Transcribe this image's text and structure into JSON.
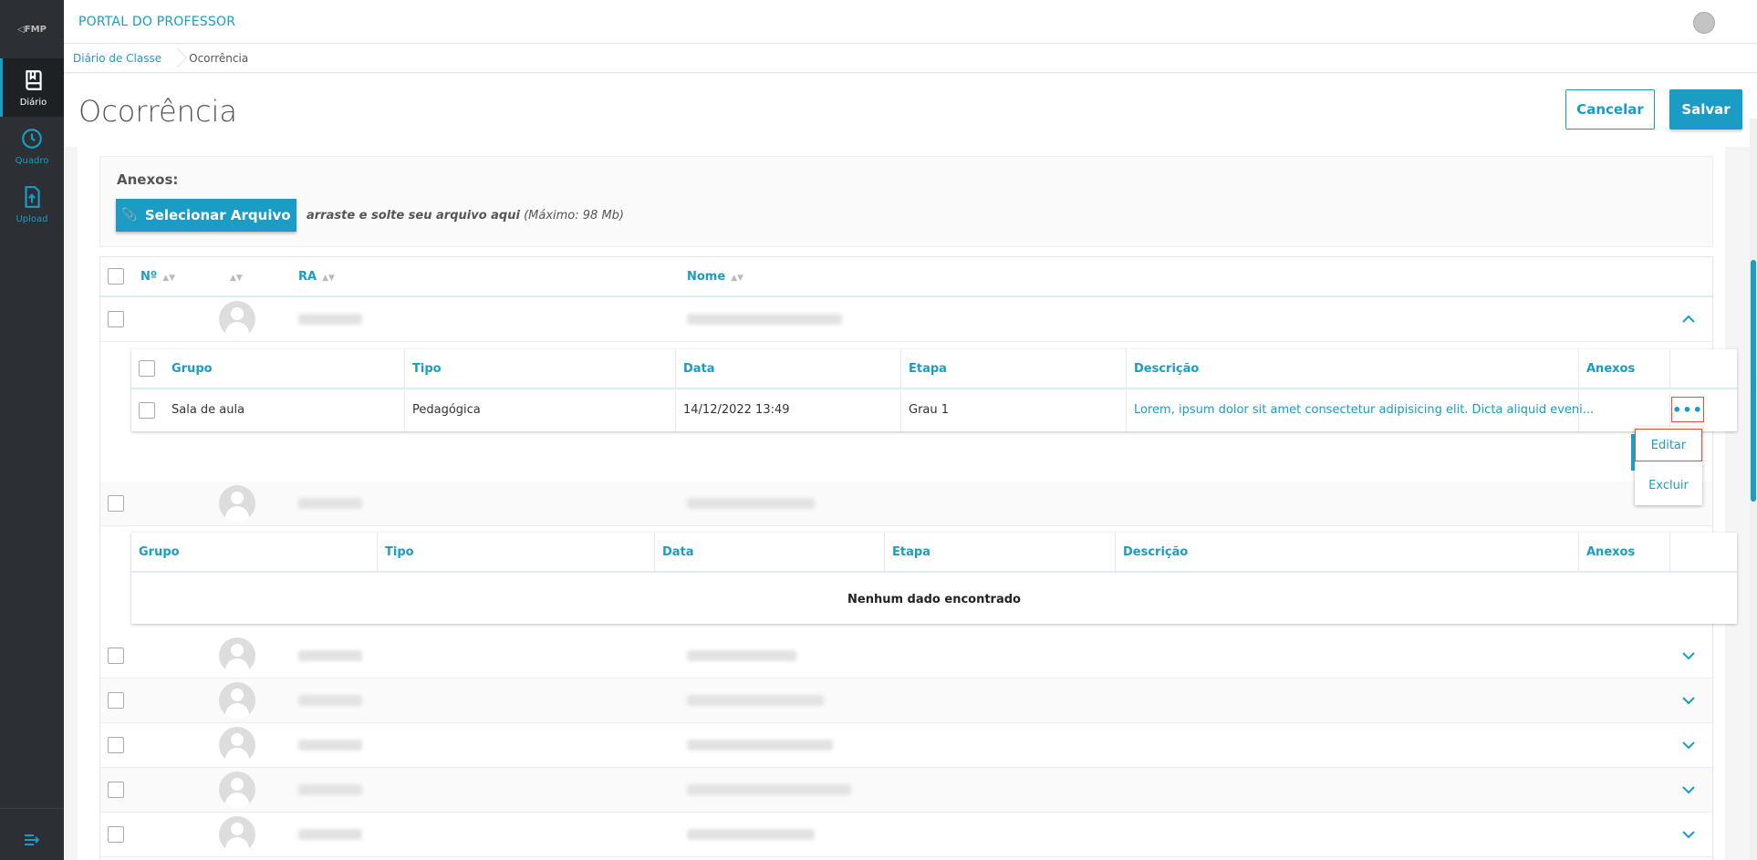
{
  "app": {
    "logo_text": "◁FMP",
    "title": "PORTAL DO PROFESSOR"
  },
  "sidebar": {
    "items": [
      {
        "label": "Diário",
        "icon": "book-icon",
        "active": true
      },
      {
        "label": "Quadro",
        "icon": "clock-icon",
        "active": false
      },
      {
        "label": "Upload",
        "icon": "upload-icon",
        "active": false
      }
    ],
    "collapse_icon": "menu-collapse-icon"
  },
  "breadcrumb": {
    "items": [
      "Diário de Classe",
      "Ocorrência"
    ]
  },
  "page": {
    "title": "Ocorrência",
    "cancel_label": "Cancelar",
    "save_label": "Salvar"
  },
  "attachments": {
    "label": "Anexos:",
    "select_button": "Selecionar Arquivo",
    "hint_bold": "arraste e solte seu arquivo aqui",
    "hint_rest": " (Máximo: 98 Mb)"
  },
  "students_table": {
    "columns": [
      "Nº",
      "",
      "RA",
      "Nome"
    ]
  },
  "occurrence_table": {
    "columns": [
      "Grupo",
      "Tipo",
      "Data",
      "Etapa",
      "Descrição",
      "Anexos"
    ],
    "rows": [
      {
        "grupo": "Sala de aula",
        "tipo": "Pedagógica",
        "data": "14/12/2022 13:49",
        "etapa": "Grau 1",
        "descricao": "Lorem, ipsum dolor sit amet consectetur adipisicing elit. Dicta aliquid eveni..."
      }
    ],
    "more_label": "•••"
  },
  "row_menu": {
    "items": [
      "Editar",
      "Excluir"
    ]
  },
  "empty_table": {
    "columns": [
      "Grupo",
      "Tipo",
      "Data",
      "Etapa",
      "Descrição",
      "Anexos"
    ],
    "empty_message": "Nenhum dado encontrado"
  },
  "colors": {
    "accent": "#1a9cc4",
    "sidebar": "#2c2f33",
    "highlight": "#e74c3c"
  }
}
